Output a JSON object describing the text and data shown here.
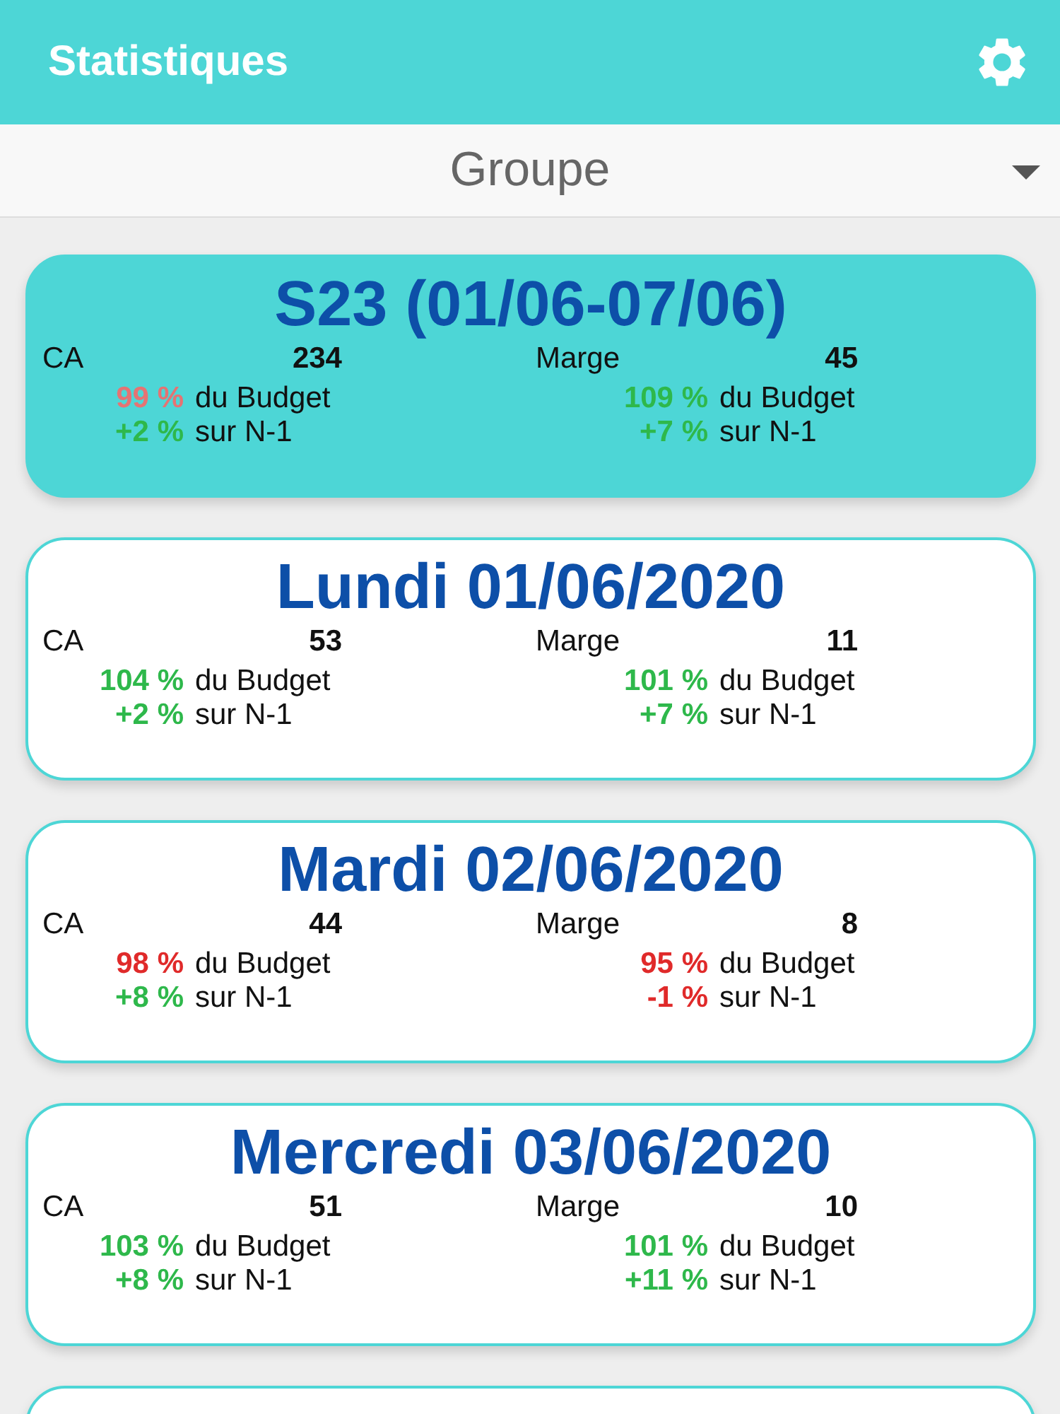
{
  "app_bar": {
    "title": "Statistiques"
  },
  "dropdown": {
    "value": "Groupe"
  },
  "cards": [
    {
      "title": "S23 (01/06-07/06)",
      "selected": true,
      "metrics": [
        {
          "label": "CA",
          "value": "234",
          "stats": [
            {
              "value": "99 %",
              "text": "du Budget",
              "color": "#e57373"
            },
            {
              "value": "+2 %",
              "text": "sur N-1",
              "color": "#2eb84b"
            }
          ]
        },
        {
          "label": "Marge",
          "value": "45",
          "stats": [
            {
              "value": "109 %",
              "text": "du Budget",
              "color": "#2eb84b"
            },
            {
              "value": "+7 %",
              "text": "sur N-1",
              "color": "#2eb84b"
            }
          ]
        }
      ]
    },
    {
      "title": "Lundi 01/06/2020",
      "selected": false,
      "metrics": [
        {
          "label": "CA",
          "value": "53",
          "stats": [
            {
              "value": "104 %",
              "text": "du Budget",
              "color": "#2eb84b"
            },
            {
              "value": "+2 %",
              "text": "sur N-1",
              "color": "#2eb84b"
            }
          ]
        },
        {
          "label": "Marge",
          "value": "11",
          "stats": [
            {
              "value": "101 %",
              "text": "du Budget",
              "color": "#2eb84b"
            },
            {
              "value": "+7 %",
              "text": "sur N-1",
              "color": "#2eb84b"
            }
          ]
        }
      ]
    },
    {
      "title": "Mardi 02/06/2020",
      "selected": false,
      "metrics": [
        {
          "label": "CA",
          "value": "44",
          "stats": [
            {
              "value": "98 %",
              "text": "du Budget",
              "color": "#e02a2a"
            },
            {
              "value": "+8 %",
              "text": "sur N-1",
              "color": "#2eb84b"
            }
          ]
        },
        {
          "label": "Marge",
          "value": "8",
          "stats": [
            {
              "value": "95 %",
              "text": "du Budget",
              "color": "#e02a2a"
            },
            {
              "value": "-1 %",
              "text": "sur N-1",
              "color": "#e02a2a"
            }
          ]
        }
      ]
    },
    {
      "title": "Mercredi 03/06/2020",
      "selected": false,
      "metrics": [
        {
          "label": "CA",
          "value": "51",
          "stats": [
            {
              "value": "103 %",
              "text": "du Budget",
              "color": "#2eb84b"
            },
            {
              "value": "+8 %",
              "text": "sur N-1",
              "color": "#2eb84b"
            }
          ]
        },
        {
          "label": "Marge",
          "value": "10",
          "stats": [
            {
              "value": "101 %",
              "text": "du Budget",
              "color": "#2eb84b"
            },
            {
              "value": "+11 %",
              "text": "sur N-1",
              "color": "#2eb84b"
            }
          ]
        }
      ]
    },
    {
      "selected": false
    }
  ]
}
